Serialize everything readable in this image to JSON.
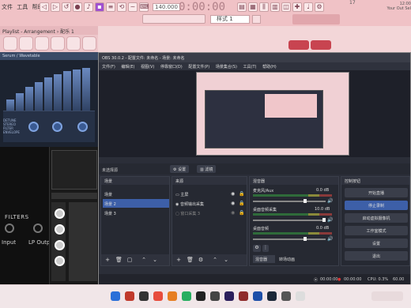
{
  "fl": {
    "menu": [
      "文件",
      "工具",
      "帮助"
    ],
    "bpm": "140.000",
    "time": "0:00:00",
    "pattern_label": "样式 1",
    "info_lines": [
      "12:00",
      "Your Out Sel"
    ],
    "cpu": "17"
  },
  "playlist": {
    "title": "Playlist - Arrangement › 配乐 1"
  },
  "synth": {
    "header": "Serum / Wavetable",
    "labels": [
      "DETUNE",
      "STEREO",
      "FILTER",
      "ENVELOPE"
    ]
  },
  "filters": {
    "title": "FILTERS",
    "input": "Input",
    "lp_output": "LP Output"
  },
  "obs": {
    "title": "OBS 30.0.2 - 配置文件: 未命名 - 场景: 未命名",
    "menu": [
      "文件(F)",
      "编辑(E)",
      "视图(V)",
      "停靠窗口(D)",
      "配置文件(P)",
      "场景集合(S)",
      "工具(T)",
      "帮助(H)"
    ],
    "no_source": "未选择源",
    "settings_btn": "设置",
    "filters_btn": "滤镜",
    "scenes": {
      "title": "场景",
      "items": [
        "场景",
        "场景 2",
        "场景 3"
      ],
      "selected": 1
    },
    "sources": {
      "title": "来源",
      "items": [
        "主屏",
        "音频输出采集",
        "窗口采集 3"
      ]
    },
    "mixer": {
      "title": "混音器",
      "tracks": [
        {
          "name": "麦克风/Aux",
          "db": "0.0 dB"
        },
        {
          "name": "桌面音频采集",
          "db": "10.0 dB"
        },
        {
          "name": "桌面音频",
          "db": "0.0 dB"
        }
      ],
      "tabs": [
        "混音器",
        "转场动画"
      ]
    },
    "controls": {
      "title": "控制按钮",
      "buttons": [
        "开始直播",
        "停止录制",
        "启动虚拟摄像机",
        "工作室模式",
        "设置",
        "退出"
      ],
      "active": 1
    },
    "status": {
      "live": "00:00:00",
      "rec": "00:00:00",
      "cpu": "CPU: 0.3%",
      "fps": "60.00"
    }
  },
  "colors": {
    "accent": "#3d5fa8",
    "fl_bg": "#f0c2c6",
    "obs_bg": "#2b2e38"
  }
}
